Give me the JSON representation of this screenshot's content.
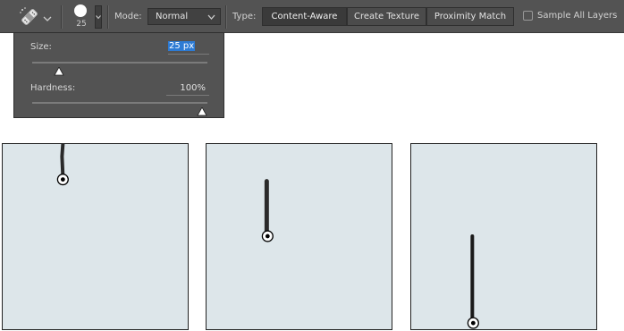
{
  "optionsBar": {
    "toolIcon": "spot-healing-brush-icon",
    "brushSize": "25",
    "modeLabel": "Mode:",
    "modeValue": "Normal",
    "typeLabel": "Type:",
    "typeButtons": [
      "Content-Aware",
      "Create Texture",
      "Proximity Match"
    ],
    "activeType": "Content-Aware",
    "sampleAllLayersLabel": "Sample All Layers",
    "sampleAllLayersChecked": false
  },
  "brushPopup": {
    "sizeLabel": "Size:",
    "sizeValue": "25 px",
    "sizeSliderFraction": 0.1,
    "hardnessLabel": "Hardness:",
    "hardnessValue": "100%",
    "hardnessSliderFraction": 1.0
  },
  "colors": {
    "panel": "#535353",
    "selection": "#2d7bd4",
    "sky": "#e3e9ec",
    "wall": "#6b5238",
    "pavement": "#5a4a38"
  },
  "photos": [
    {
      "stroke": "start"
    },
    {
      "stroke": "middle"
    },
    {
      "stroke": "end"
    }
  ]
}
